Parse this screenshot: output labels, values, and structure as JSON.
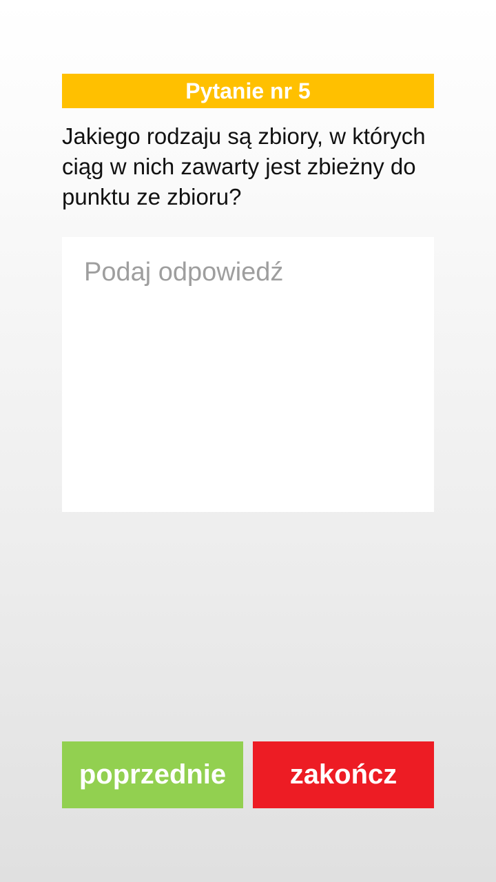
{
  "header": {
    "title": "Pytanie nr 5",
    "color": "#ffc000"
  },
  "question": {
    "text": "Jakiego rodzaju są zbiory, w których ciąg w nich zawarty jest zbieżny do punktu ze zbioru?"
  },
  "answer": {
    "value": "",
    "placeholder": "Podaj odpowiedź"
  },
  "buttons": {
    "previous_label": "poprzednie",
    "previous_color": "#92d050",
    "finish_label": "zakończ",
    "finish_color": "#ed1c24"
  }
}
